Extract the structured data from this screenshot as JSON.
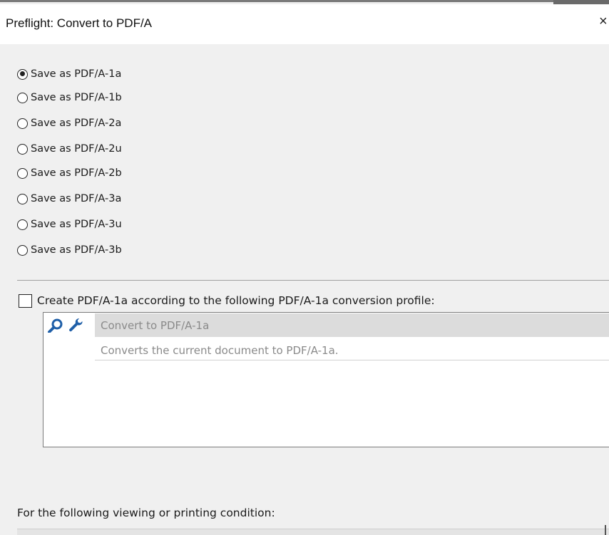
{
  "dialog": {
    "title": "Preflight: Convert to PDF/A",
    "close_label": "×"
  },
  "radio_options": [
    {
      "label": "Save as PDF/A-1a",
      "checked": true
    },
    {
      "label": "Save as PDF/A-1b",
      "checked": false
    },
    {
      "label": "Save as PDF/A-2a",
      "checked": false
    },
    {
      "label": "Save as PDF/A-2u",
      "checked": false
    },
    {
      "label": "Save as PDF/A-2b",
      "checked": false
    },
    {
      "label": "Save as PDF/A-3a",
      "checked": false
    },
    {
      "label": "Save as PDF/A-3u",
      "checked": false
    },
    {
      "label": "Save as PDF/A-3b",
      "checked": false
    }
  ],
  "conversion": {
    "checkbox_label": "Create PDF/A-1a according to the following PDF/A-1a conversion profile:",
    "checked": false,
    "profile": {
      "name": "Convert to PDF/A-1a",
      "description": "Converts the current document to PDF/A-1a.",
      "icons": [
        "magnifier-icon",
        "wrench-icon"
      ]
    }
  },
  "condition": {
    "label": "For the following viewing or printing condition:",
    "selected": ""
  },
  "colors": {
    "icon_blue": "#1f5fa8",
    "disabled_text": "#8a8a8a",
    "highlight_row": "#dcdcdc"
  }
}
